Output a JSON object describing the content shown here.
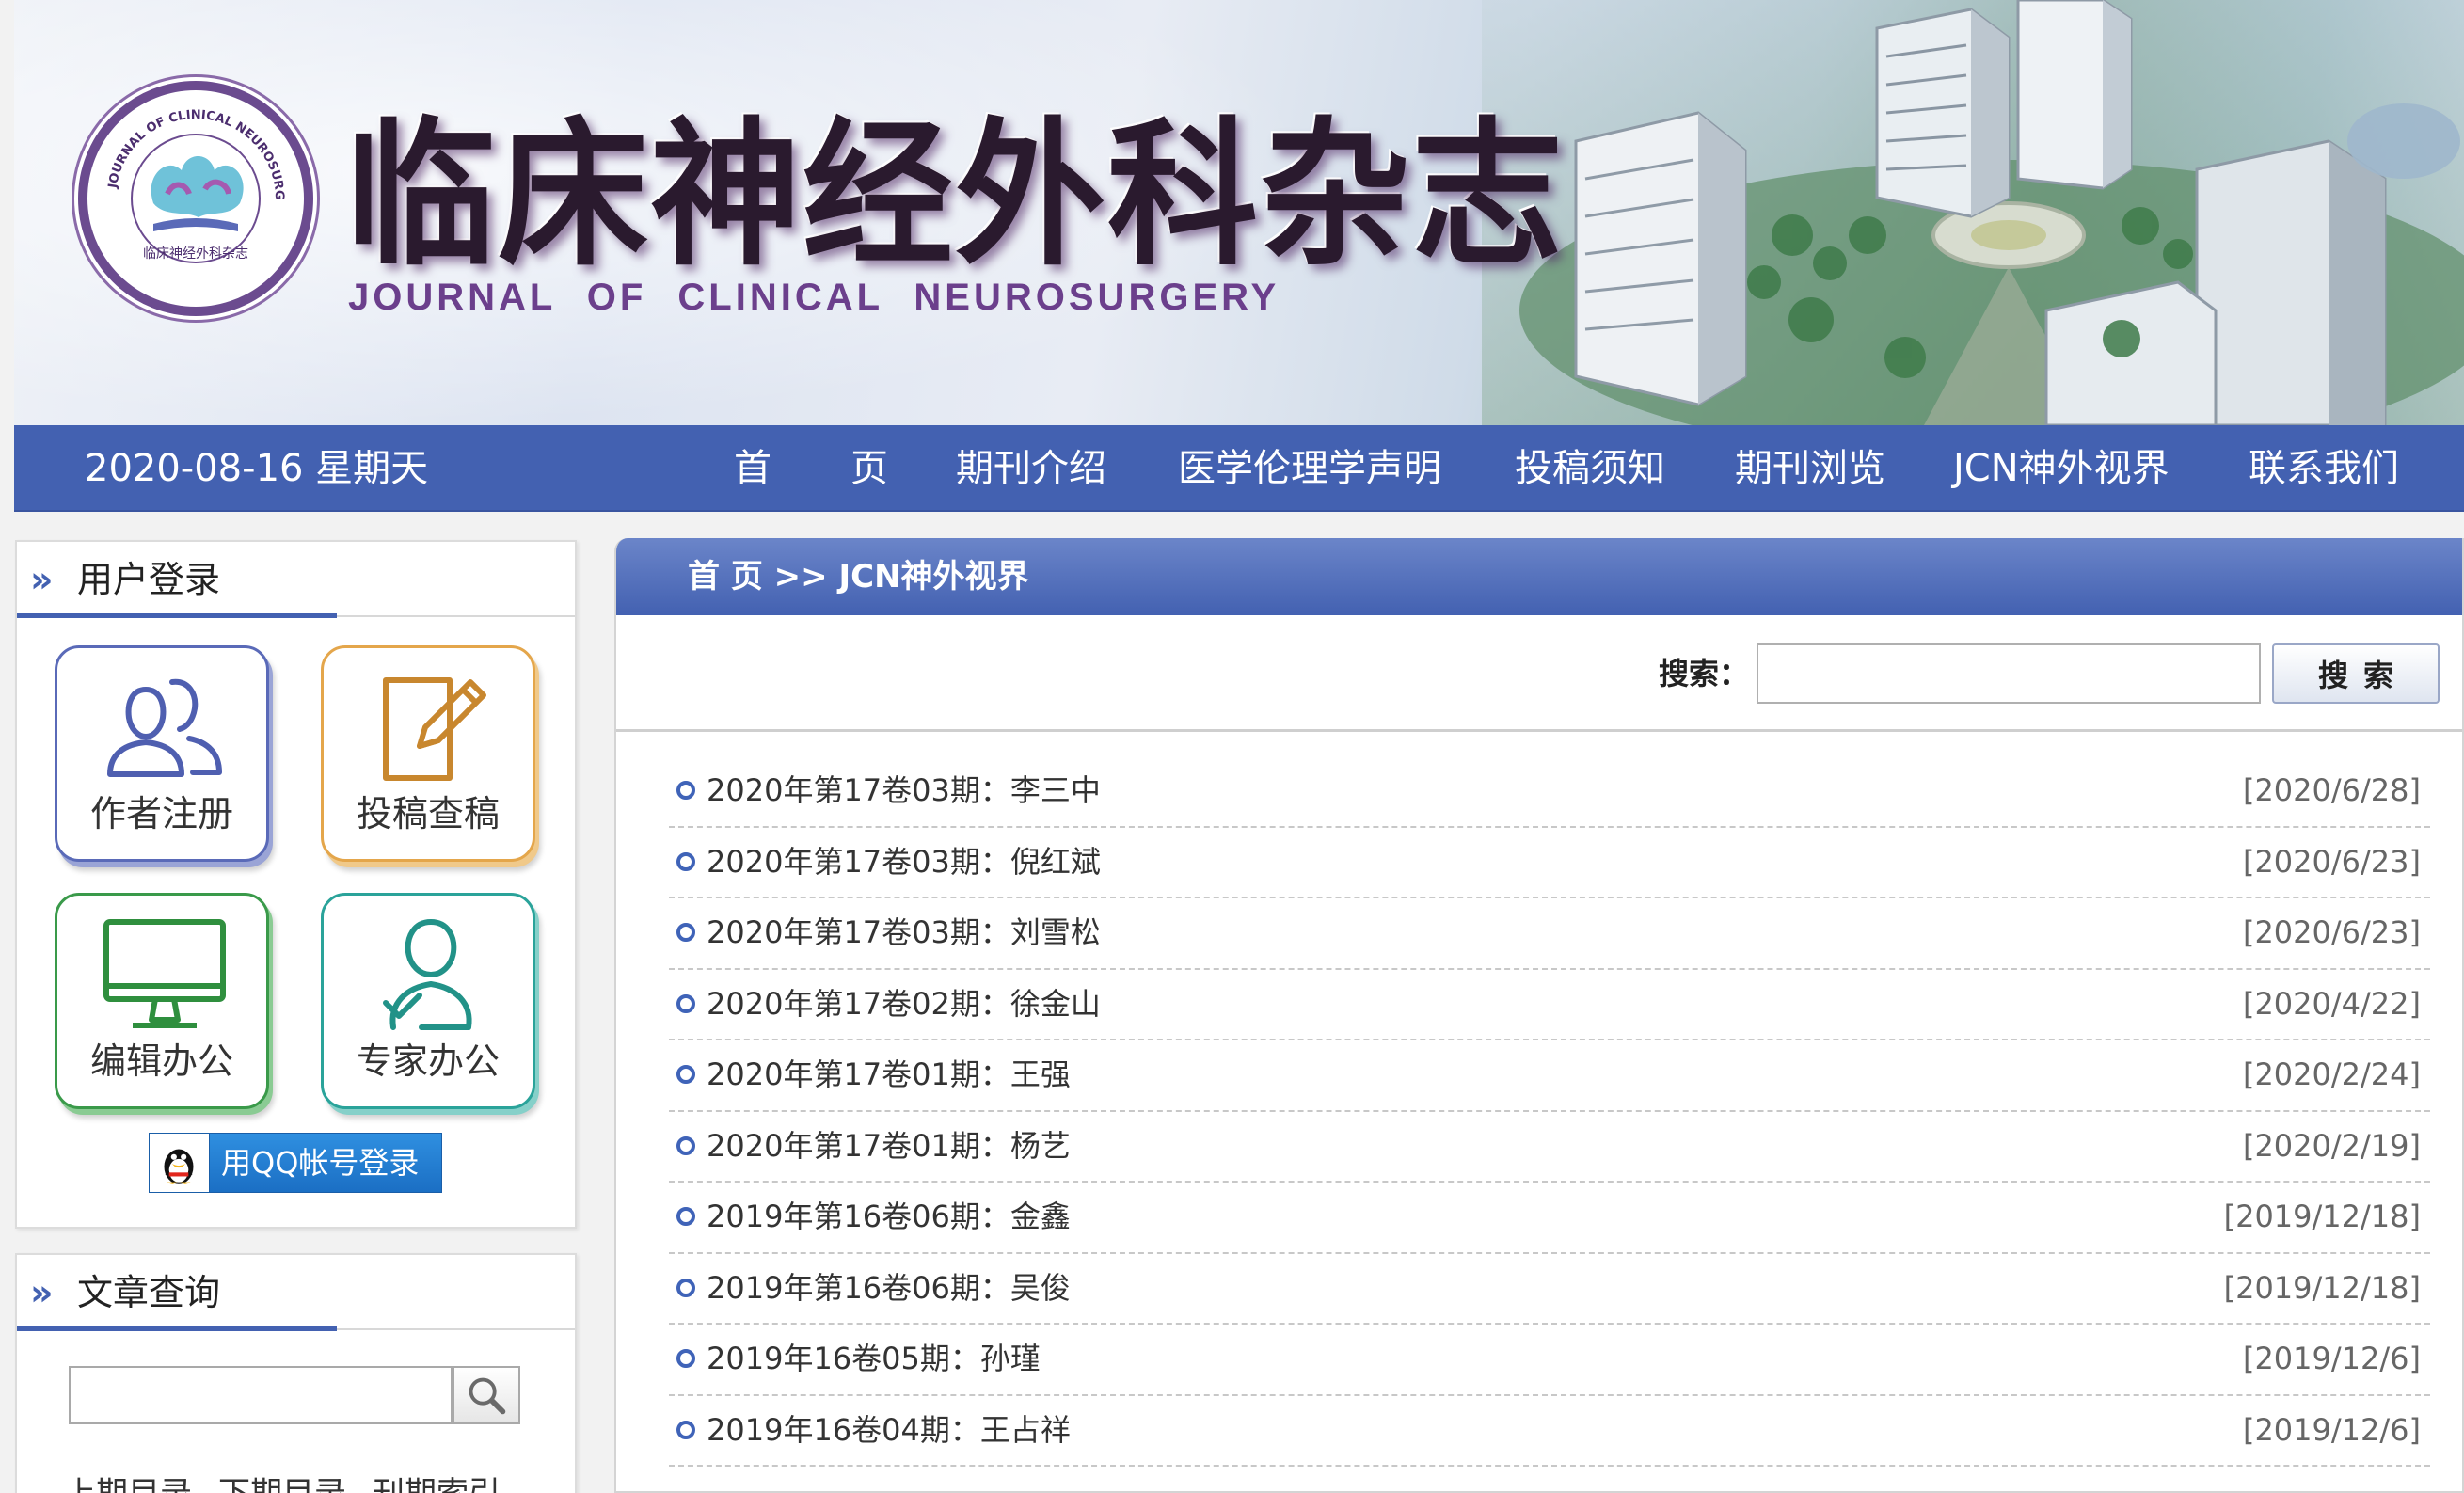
{
  "header": {
    "title_cn": "临床神经外科杂志",
    "title_en": "JOURNAL OF CLINICAL NEUROSURGERY",
    "logo_ring_text": "JOURNAL OF CLINICAL NEUROSURGERY",
    "logo_caption": "临床神经外科杂志"
  },
  "nav": {
    "date": "2020-08-16 星期天",
    "items": [
      {
        "label": "首"
      },
      {
        "label": "页"
      },
      {
        "label": "期刊介绍"
      },
      {
        "label": "医学伦理学声明"
      },
      {
        "label": "投稿须知"
      },
      {
        "label": "期刊浏览"
      },
      {
        "label": "JCN神外视界"
      },
      {
        "label": "联系我们"
      }
    ]
  },
  "login_panel": {
    "title": "用户登录",
    "tiles": [
      {
        "label": "作者注册",
        "icon": "users-icon"
      },
      {
        "label": "投稿查稿",
        "icon": "edit-document-icon"
      },
      {
        "label": "编辑办公",
        "icon": "monitor-icon"
      },
      {
        "label": "专家办公",
        "icon": "user-check-icon"
      }
    ],
    "qq_login": "用QQ帐号登录"
  },
  "search_panel": {
    "title": "文章查询",
    "input_value": "",
    "links": [
      "上期目录",
      "下期目录",
      "刊期索引"
    ]
  },
  "main": {
    "breadcrumb": "首 页 >> JCN神外视界",
    "search_label": "搜索：",
    "search_value": "",
    "search_button": "搜索",
    "articles": [
      {
        "title": "2020年第17卷03期：李三中",
        "date": "[2020/6/28]"
      },
      {
        "title": "2020年第17卷03期：倪红斌",
        "date": "[2020/6/23]"
      },
      {
        "title": "2020年第17卷03期：刘雪松",
        "date": "[2020/6/23]"
      },
      {
        "title": "2020年第17卷02期：徐金山",
        "date": "[2020/4/22]"
      },
      {
        "title": "2020年第17卷01期：王强",
        "date": "[2020/2/24]"
      },
      {
        "title": "2020年第17卷01期：杨艺",
        "date": "[2020/2/19]"
      },
      {
        "title": "2019年第16卷06期：金鑫",
        "date": "[2019/12/18]"
      },
      {
        "title": "2019年第16卷06期：吴俊",
        "date": "[2019/12/18]"
      },
      {
        "title": "2019年16卷05期：孙瑾",
        "date": "[2019/12/6]"
      },
      {
        "title": "2019年16卷04期：王占祥",
        "date": "[2019/12/6]"
      }
    ]
  },
  "colors": {
    "nav_blue": "#4361b1",
    "logo_purple": "#6b4b8f",
    "bullet_blue": "#3f63b8"
  }
}
